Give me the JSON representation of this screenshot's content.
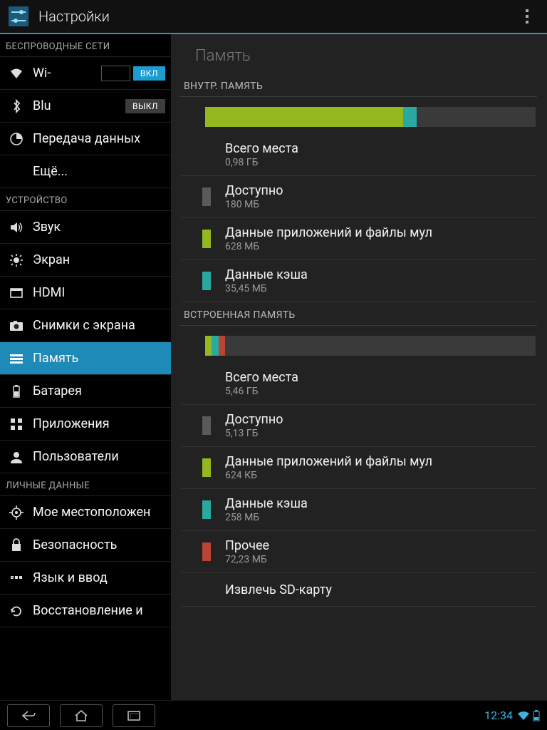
{
  "colors": {
    "accent": "#1b9dd2",
    "green": "#93b71f",
    "teal": "#2aa9a1",
    "grey": "#5a5a5a",
    "red": "#b94435"
  },
  "actionbar": {
    "title": "Настройки"
  },
  "sidebar": {
    "sections": [
      {
        "header": "БЕСПРОВОДНЫЕ СЕТИ",
        "items": [
          {
            "id": "wifi",
            "icon": "wifi",
            "label": "Wi-Fi",
            "display_label": "Wi-",
            "toggle": "on",
            "toggle_label": "ВКЛ"
          },
          {
            "id": "bt",
            "icon": "bluetooth",
            "label": "Bluetooth",
            "display_label": "Blu",
            "toggle": "off",
            "toggle_label": "ВЫКЛ"
          },
          {
            "id": "datausage",
            "icon": "data",
            "label": "Передача данных"
          },
          {
            "id": "more",
            "icon": "",
            "label": "Ещё..."
          }
        ]
      },
      {
        "header": "УСТРОЙСТВО",
        "items": [
          {
            "id": "sound",
            "icon": "sound",
            "label": "Звук"
          },
          {
            "id": "display",
            "icon": "display",
            "label": "Экран"
          },
          {
            "id": "hdmi",
            "icon": "hdmi",
            "label": "HDMI"
          },
          {
            "id": "screenshot",
            "icon": "camera",
            "label": "Снимки с экрана"
          },
          {
            "id": "storage",
            "icon": "storage",
            "label": "Память",
            "active": true
          },
          {
            "id": "battery",
            "icon": "battery",
            "label": "Батарея"
          },
          {
            "id": "apps",
            "icon": "apps",
            "label": "Приложения"
          },
          {
            "id": "users",
            "icon": "users",
            "label": "Пользователи"
          }
        ]
      },
      {
        "header": "ЛИЧНЫЕ ДАННЫЕ",
        "items": [
          {
            "id": "location",
            "icon": "location",
            "label": "Мое местоположен"
          },
          {
            "id": "security",
            "icon": "lock",
            "label": "Безопасность"
          },
          {
            "id": "language",
            "icon": "language",
            "label": "Язык и ввод"
          },
          {
            "id": "backup",
            "icon": "backup",
            "label": "Восстановление и"
          }
        ]
      }
    ]
  },
  "content": {
    "title": "Память",
    "groups": [
      {
        "name": "ВНУТР. ПАМЯТЬ",
        "bar": [
          {
            "color": "#93b71f",
            "pct": 60
          },
          {
            "color": "#2aa9a1",
            "pct": 4
          }
        ],
        "rows": [
          {
            "swatch": null,
            "title": "Всего места",
            "sub": "0,98 ГБ"
          },
          {
            "swatch": "#5a5a5a",
            "title": "Доступно",
            "sub": "180 МБ"
          },
          {
            "swatch": "#93b71f",
            "title": "Данные приложений и файлы мул",
            "sub": "628 МБ"
          },
          {
            "swatch": "#2aa9a1",
            "title": "Данные кэша",
            "sub": "35,45 МБ"
          }
        ]
      },
      {
        "name": "ВСТРОЕННАЯ ПАМЯТЬ",
        "bar": [
          {
            "color": "#93b71f",
            "pct": 2
          },
          {
            "color": "#2aa9a1",
            "pct": 2
          },
          {
            "color": "#b94435",
            "pct": 2
          }
        ],
        "rows": [
          {
            "swatch": null,
            "title": "Всего места",
            "sub": "5,46 ГБ"
          },
          {
            "swatch": "#5a5a5a",
            "title": "Доступно",
            "sub": "5,13 ГБ"
          },
          {
            "swatch": "#93b71f",
            "title": "Данные приложений и файлы мул",
            "sub": "624 КБ"
          },
          {
            "swatch": "#2aa9a1",
            "title": "Данные кэша",
            "sub": "258 МБ"
          },
          {
            "swatch": "#b94435",
            "title": "Прочее",
            "sub": "72,23 МБ"
          },
          {
            "swatch": null,
            "title": "Извлечь SD-карту",
            "sub": ""
          }
        ]
      }
    ]
  },
  "statusbar": {
    "time": "12:34"
  }
}
